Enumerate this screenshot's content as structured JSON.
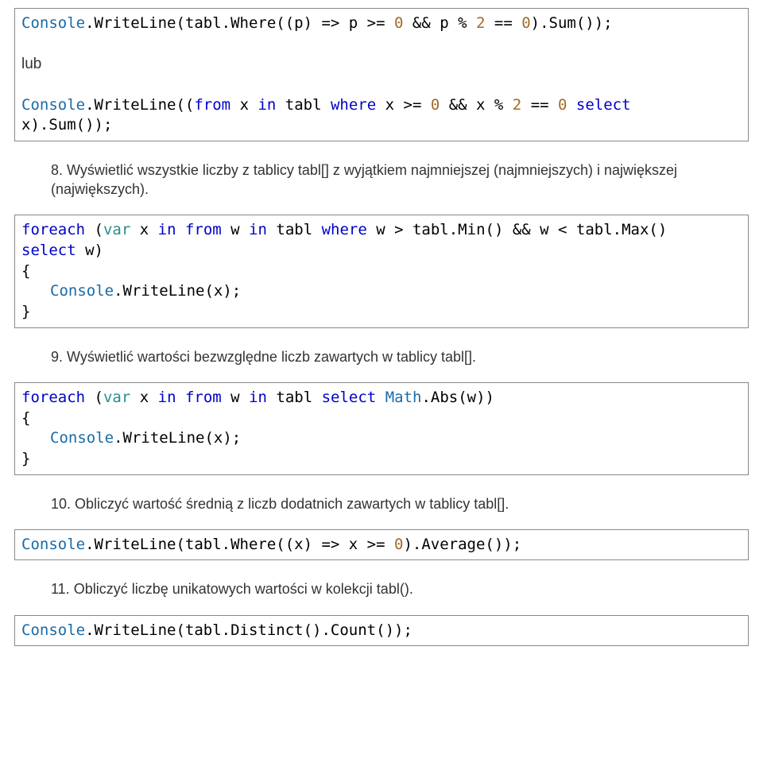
{
  "blocks": [
    {
      "type": "code",
      "lines": [
        {
          "segments": [
            {
              "t": "Console",
              "c": "tok-class"
            },
            {
              "t": ".WriteLine(tabl.Where((p) => p >= "
            },
            {
              "t": "0",
              "c": "tok-num"
            },
            {
              "t": " && p % "
            },
            {
              "t": "2",
              "c": "tok-num"
            },
            {
              "t": " == "
            },
            {
              "t": "0",
              "c": "tok-num"
            },
            {
              "t": ").Sum());"
            }
          ]
        },
        {
          "segments": [
            {
              "t": " "
            }
          ]
        },
        {
          "segments": [
            {
              "t": "lub"
            }
          ],
          "plain": true
        },
        {
          "segments": [
            {
              "t": " "
            }
          ]
        },
        {
          "segments": [
            {
              "t": "Console",
              "c": "tok-class"
            },
            {
              "t": ".WriteLine(("
            },
            {
              "t": "from",
              "c": "tok-kw"
            },
            {
              "t": " x "
            },
            {
              "t": "in",
              "c": "tok-kw"
            },
            {
              "t": " tabl "
            },
            {
              "t": "where",
              "c": "tok-kw"
            },
            {
              "t": " x >= "
            },
            {
              "t": "0",
              "c": "tok-num"
            },
            {
              "t": " && x % "
            },
            {
              "t": "2",
              "c": "tok-num"
            },
            {
              "t": " == "
            },
            {
              "t": "0",
              "c": "tok-num"
            },
            {
              "t": " "
            },
            {
              "t": "select",
              "c": "tok-kw"
            }
          ]
        },
        {
          "segments": [
            {
              "t": "x).Sum());"
            }
          ]
        }
      ]
    },
    {
      "type": "para",
      "text": "8. Wyświetlić wszystkie liczby z tablicy tabl[] z wyjątkiem najmniejszej (najmniejszych) i największej (największych).",
      "indent": true
    },
    {
      "type": "code",
      "lines": [
        {
          "segments": [
            {
              "t": "foreach",
              "c": "tok-kw"
            },
            {
              "t": " ("
            },
            {
              "t": "var",
              "c": "tok-type"
            },
            {
              "t": " x "
            },
            {
              "t": "in",
              "c": "tok-kw"
            },
            {
              "t": " "
            },
            {
              "t": "from",
              "c": "tok-kw"
            },
            {
              "t": " w "
            },
            {
              "t": "in",
              "c": "tok-kw"
            },
            {
              "t": " tabl "
            },
            {
              "t": "where",
              "c": "tok-kw"
            },
            {
              "t": " w > tabl.Min() && w < tabl.Max()"
            }
          ]
        },
        {
          "segments": [
            {
              "t": "select",
              "c": "tok-kw"
            },
            {
              "t": " w)"
            }
          ]
        },
        {
          "segments": [
            {
              "t": "{"
            }
          ]
        },
        {
          "segments": [
            {
              "t": "Console",
              "c": "tok-class"
            },
            {
              "t": ".WriteLine(x);"
            }
          ],
          "indent": "ind1"
        },
        {
          "segments": [
            {
              "t": "}"
            }
          ]
        }
      ]
    },
    {
      "type": "para",
      "text": "9. Wyświetlić wartości bezwzględne liczb zawartych w tablicy tabl[].",
      "indent": true
    },
    {
      "type": "code",
      "lines": [
        {
          "segments": [
            {
              "t": "foreach",
              "c": "tok-kw"
            },
            {
              "t": " ("
            },
            {
              "t": "var",
              "c": "tok-type"
            },
            {
              "t": " x "
            },
            {
              "t": "in",
              "c": "tok-kw"
            },
            {
              "t": " "
            },
            {
              "t": "from",
              "c": "tok-kw"
            },
            {
              "t": " w "
            },
            {
              "t": "in",
              "c": "tok-kw"
            },
            {
              "t": " tabl "
            },
            {
              "t": "select",
              "c": "tok-kw"
            },
            {
              "t": " "
            },
            {
              "t": "Math",
              "c": "tok-class"
            },
            {
              "t": ".Abs(w))"
            }
          ]
        },
        {
          "segments": [
            {
              "t": "{"
            }
          ]
        },
        {
          "segments": [
            {
              "t": "Console",
              "c": "tok-class"
            },
            {
              "t": ".WriteLine(x);"
            }
          ],
          "indent": "ind1"
        },
        {
          "segments": [
            {
              "t": "}"
            }
          ]
        }
      ]
    },
    {
      "type": "para",
      "text": "10. Obliczyć wartość średnią z liczb dodatnich zawartych w tablicy tabl[].",
      "indent": true
    },
    {
      "type": "code",
      "lines": [
        {
          "segments": [
            {
              "t": "Console",
              "c": "tok-class"
            },
            {
              "t": ".WriteLine(tabl.Where((x) => x >= "
            },
            {
              "t": "0",
              "c": "tok-num"
            },
            {
              "t": ").Average());"
            }
          ]
        }
      ]
    },
    {
      "type": "para",
      "text": "11. Obliczyć liczbę unikatowych wartości w kolekcji tabl().",
      "indent": true
    },
    {
      "type": "code",
      "lines": [
        {
          "segments": [
            {
              "t": "Console",
              "c": "tok-class"
            },
            {
              "t": ".WriteLine(tabl.Distinct().Count());"
            }
          ]
        }
      ]
    }
  ]
}
